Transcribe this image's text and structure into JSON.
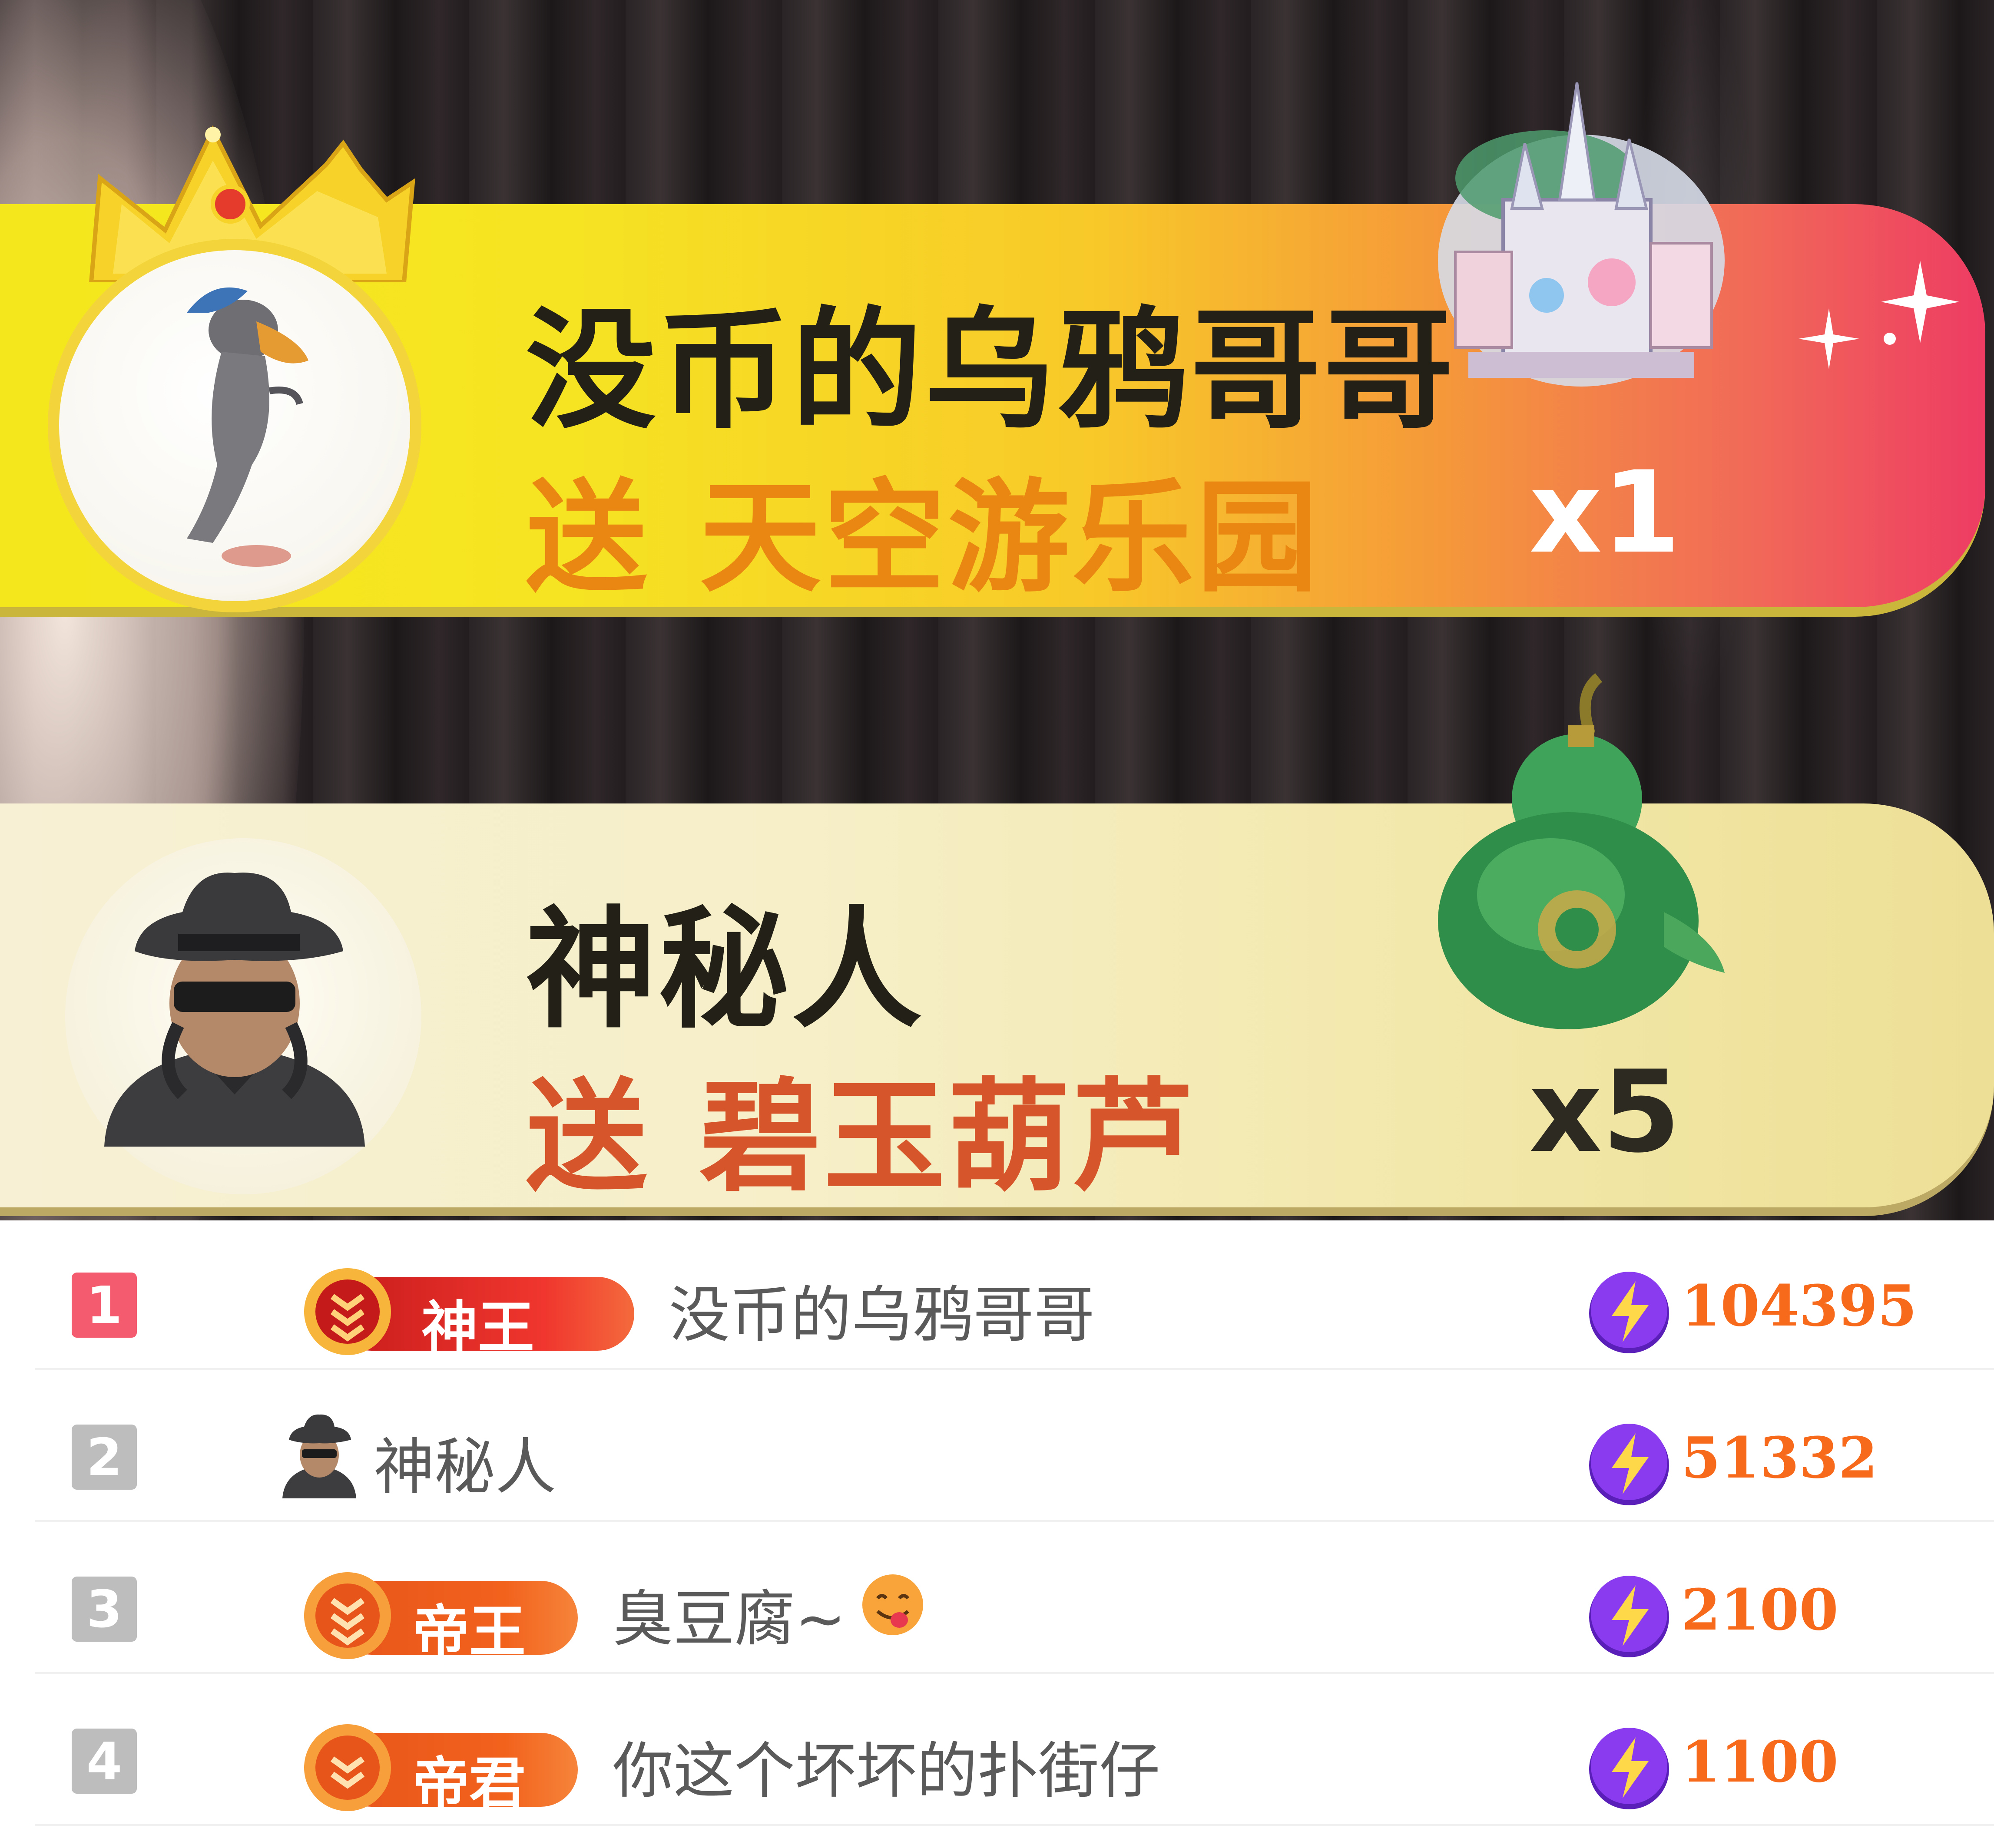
{
  "gift_banners": [
    {
      "sender": "没币的乌鸦哥哥",
      "action": "送",
      "gift": "天空游乐园",
      "count": "x1",
      "avatar_icon": "crow-avatar-icon",
      "frame_icon": "crown-icon",
      "gift_icon": "sky-castle-gift-icon"
    },
    {
      "sender": "神秘人",
      "action": "送",
      "gift": "碧玉葫芦",
      "count": "x5",
      "avatar_icon": "mystery-person-avatar-icon",
      "gift_icon": "jade-gourd-gift-icon"
    }
  ],
  "ranking": [
    {
      "rank": "1",
      "rank_color": "#f45b6e",
      "badge": "神王",
      "badge_color": "#e8262a",
      "name": "没币的乌鸦哥哥",
      "score": "104395"
    },
    {
      "rank": "2",
      "rank_color": "#bdbdbd",
      "badge": "",
      "name": "神秘人",
      "score": "51332"
    },
    {
      "rank": "3",
      "rank_color": "#bdbdbd",
      "badge": "帝王",
      "badge_color": "#f2621d",
      "name": "臭豆腐~",
      "score": "2100"
    },
    {
      "rank": "4",
      "rank_color": "#bdbdbd",
      "badge": "帝君",
      "badge_color": "#f2621d",
      "name": "你这个坏坏的扑街仔",
      "score": "1100"
    }
  ],
  "colors": {
    "score_text": "#f86a1b",
    "score_icon": "#8a3bf0"
  }
}
